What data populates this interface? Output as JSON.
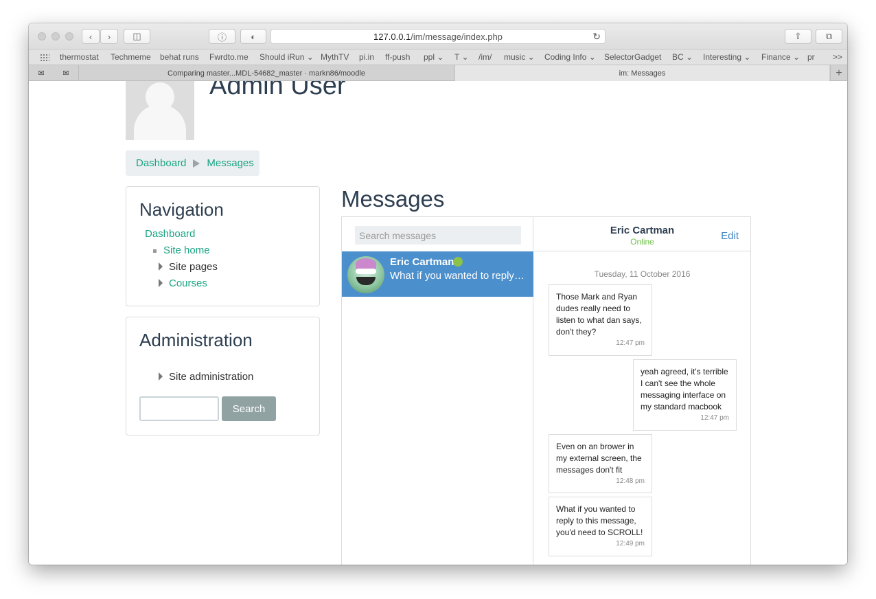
{
  "browser": {
    "url_host": "127.0.0.1",
    "url_path": "/im/message/index.php",
    "bookmarks": [
      "thermostat",
      "Techmeme",
      "behat runs",
      "Fwrdto.me",
      "Should iRun",
      "MythTV",
      "pi.in",
      "ff-push",
      "ppl",
      "T",
      "/im/",
      "music",
      "Coding Info",
      "SelectorGadget",
      "BC",
      "Interesting",
      "Finance",
      "pr"
    ],
    "bookmarks_overflow": ">>",
    "tabs": [
      "Comparing master...MDL-54682_master · markn86/moodle",
      "im: Messages"
    ],
    "new_tab": "+"
  },
  "header": {
    "user_name": "Admin User"
  },
  "breadcrumb": {
    "items": [
      "Dashboard",
      "Messages"
    ]
  },
  "navigation": {
    "title": "Navigation",
    "dashboard": "Dashboard",
    "site_home": "Site home",
    "site_pages": "Site pages",
    "courses": "Courses"
  },
  "administration": {
    "title": "Administration",
    "site_admin": "Site administration",
    "search_button": "Search",
    "search_value": ""
  },
  "messages": {
    "title": "Messages",
    "search_placeholder": "Search messages",
    "contact": {
      "name": "Eric Cartman",
      "preview": "What if you wanted to reply to this message, you'd need to SCROLL!"
    },
    "conversation": {
      "name": "Eric Cartman",
      "status": "Online",
      "edit_label": "Edit",
      "date": "Tuesday, 11 October 2016",
      "items": [
        {
          "text": "Those Mark and Ryan dudes really need to listen to what dan says, don't they?",
          "time": "12:47 pm"
        },
        {
          "text": "yeah agreed, it's terrible I can't see the whole messaging interface on my standard macbook",
          "time": "12:47 pm"
        },
        {
          "text": "Even on an brower in my external screen, the messages don't fit",
          "time": "12:48 pm"
        },
        {
          "text": "What if you wanted to reply to this message, you'd need to SCROLL!",
          "time": "12:49 pm"
        }
      ]
    }
  },
  "colors": {
    "link": "#1aa484",
    "selected": "#4b8fcc",
    "online": "#6fc24a",
    "heading": "#2d3e50"
  }
}
